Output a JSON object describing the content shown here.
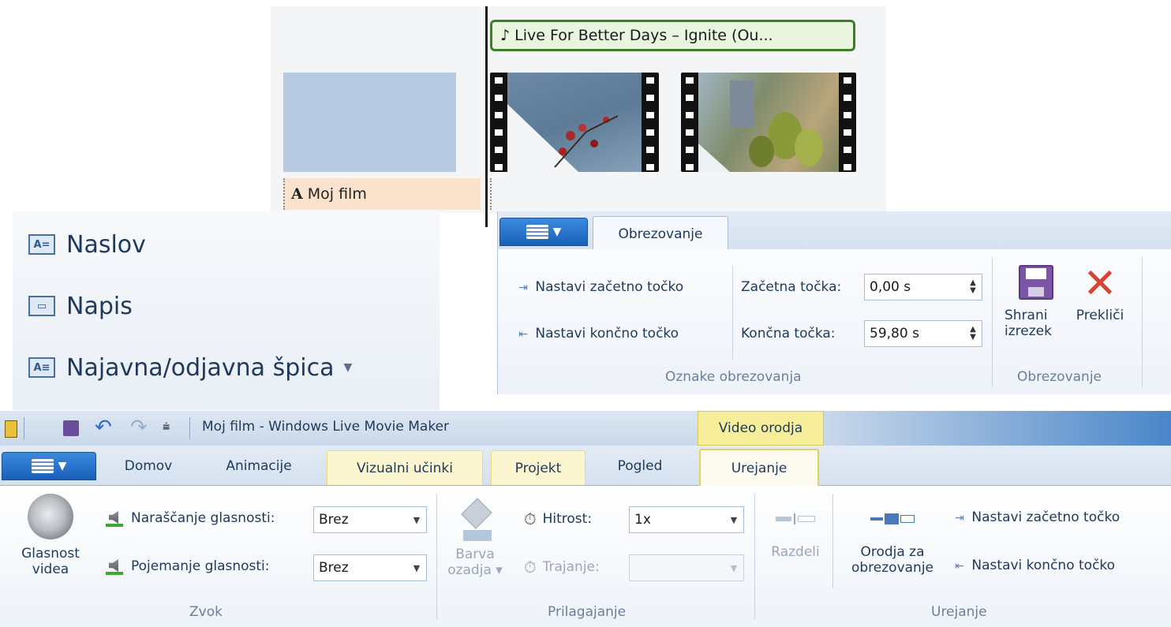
{
  "timeline": {
    "music_label": "Live For Better Days – Ignite (Ou...",
    "music_icon": "music-note-icon",
    "caption_icon": "A",
    "caption_label": "Moj film"
  },
  "title_menu": {
    "items": [
      {
        "icon": "title-icon",
        "label": "Naslov"
      },
      {
        "icon": "caption-icon",
        "label": "Napis"
      },
      {
        "icon": "credits-icon",
        "label": "Najavna/odjavna špica"
      }
    ]
  },
  "trim_ribbon": {
    "tab": "Obrezovanje",
    "set_start": "Nastavi začetno točko",
    "set_end": "Nastavi končno točko",
    "start_label": "Začetna točka:",
    "start_value": "0,00 s",
    "end_label": "Končna točka:",
    "end_value": "59,80 s",
    "save_label_1": "Shrani",
    "save_label_2": "izrezek",
    "cancel_label": "Prekliči",
    "group_markers": "Oznake obrezovanja",
    "group_trim": "Obrezovanje"
  },
  "main_ribbon": {
    "window_title": "Moj film - Windows Live Movie Maker",
    "context_label": "Video orodja",
    "tabs": [
      "Domov",
      "Animacije",
      "Vizualni učinki",
      "Projekt",
      "Pogled",
      "Urejanje"
    ],
    "volume_label_1": "Glasnost",
    "volume_label_2": "videa",
    "fade_in_label": "Naraščanje glasnosti:",
    "fade_in_value": "Brez",
    "fade_out_label": "Pojemanje glasnosti:",
    "fade_out_value": "Brez",
    "group_audio": "Zvok",
    "bg_color_1": "Barva",
    "bg_color_2": "ozadja",
    "speed_label": "Hitrost:",
    "speed_value": "1x",
    "duration_label": "Trajanje:",
    "duration_value": "",
    "group_adjust": "Prilagajanje",
    "split_label": "Razdeli",
    "trim_tool_1": "Orodja za",
    "trim_tool_2": "obrezovanje",
    "set_start": "Nastavi začetno točko",
    "set_end": "Nastavi končno točko",
    "group_edit": "Urejanje"
  },
  "colors": {
    "music_border": "#3f7d2a",
    "caption_bg": "#fbe2cc",
    "context_tab": "#f6ee9a",
    "cancel_red": "#d64533",
    "save_purple": "#7b55a6"
  }
}
